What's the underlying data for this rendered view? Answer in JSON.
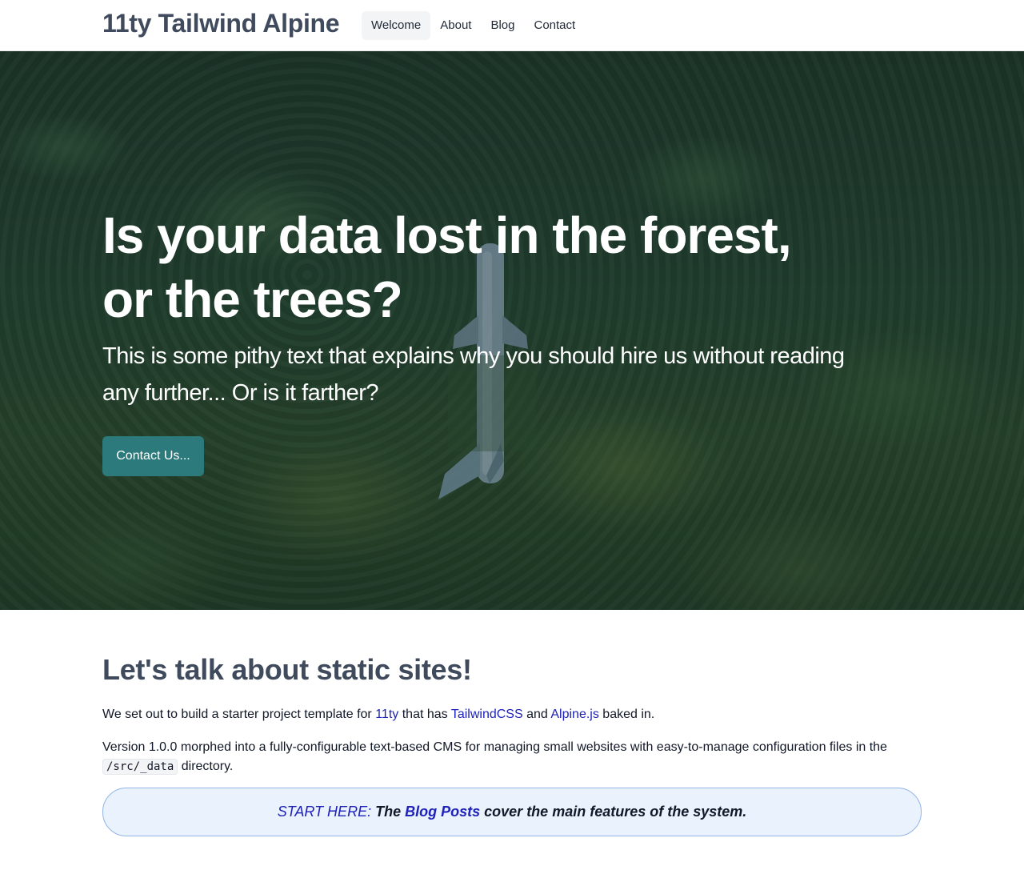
{
  "header": {
    "brand": "11ty Tailwind Alpine",
    "nav": [
      {
        "label": "Welcome",
        "active": true
      },
      {
        "label": "About",
        "active": false
      },
      {
        "label": "Blog",
        "active": false
      },
      {
        "label": "Contact",
        "active": false
      }
    ]
  },
  "hero": {
    "title_line1": "Is your data lost in the forest,",
    "title_line2": "or the trees?",
    "subtitle": "This is some pithy text that explains why you should hire us without reading any further... Or is it farther?",
    "cta_label": "Contact Us...",
    "cta_color": "#2c7a7b"
  },
  "intro": {
    "heading": "Let's talk about static sites!",
    "p1_before": "We set out to build a starter project template for",
    "p1_link1": "11ty",
    "p1_mid1": "that has",
    "p1_link2": "TailwindCSS",
    "p1_mid2": "and",
    "p1_link3": "Alpine.js",
    "p1_after": "baked in.",
    "p2_before": "Version 1.0.0 morphed into a fully-configurable text-based CMS for managing small websites with easy-to-manage configuration files in the",
    "p2_code": "/src/_data",
    "p2_after": "directory."
  },
  "callout": {
    "start": "START HERE:",
    "before": "The",
    "link": "Blog Posts",
    "after": "cover the main features of the system."
  }
}
